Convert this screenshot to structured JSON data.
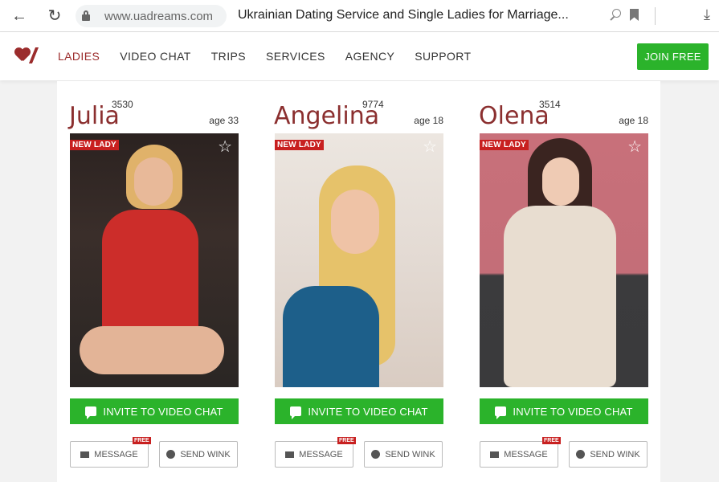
{
  "browser": {
    "url": "www.uadreams.com",
    "tab_title": "Ukrainian Dating Service and Single Ladies for Marriage..."
  },
  "header": {
    "menu": [
      "LADIES",
      "VIDEO CHAT",
      "TRIPS",
      "SERVICES",
      "AGENCY",
      "SUPPORT"
    ],
    "active": "LADIES",
    "join_label": "JOIN FREE"
  },
  "cards": [
    {
      "name": "Julia",
      "id": "3530",
      "age": "age 33",
      "badge": "NEW LADY",
      "invite": "INVITE TO VIDEO CHAT",
      "message": "MESSAGE",
      "free": "FREE",
      "wink": "SEND WINK"
    },
    {
      "name": "Angelina",
      "id": "9774",
      "age": "age 18",
      "badge": "NEW LADY",
      "invite": "INVITE TO VIDEO CHAT",
      "message": "MESSAGE",
      "free": "FREE",
      "wink": "SEND WINK"
    },
    {
      "name": "Olena",
      "id": "3514",
      "age": "age 18",
      "badge": "NEW LADY",
      "invite": "INVITE TO VIDEO CHAT",
      "message": "MESSAGE",
      "free": "FREE",
      "wink": "SEND WINK"
    }
  ],
  "colors": {
    "accent": "#9b2c2c",
    "green": "#2bb32b",
    "badge": "#c82020"
  }
}
